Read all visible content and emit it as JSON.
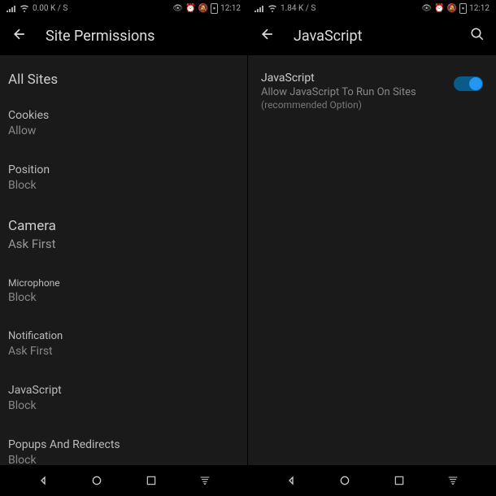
{
  "left": {
    "status": {
      "network_speed": "0.00 K / S",
      "time": "12:12"
    },
    "header": {
      "title": "Site Permissions"
    },
    "section_title": "All Sites",
    "settings": [
      {
        "label": "Cookies",
        "value": "Allow"
      },
      {
        "label": "Position",
        "value": "Block"
      },
      {
        "label": "Camera",
        "value": "Ask First"
      },
      {
        "label": "Microphone",
        "value": "Block"
      },
      {
        "label": "Notification",
        "value": "Ask First"
      },
      {
        "label": "JavaScript",
        "value": "Block"
      },
      {
        "label": "Popups And Redirects",
        "value": "Block"
      }
    ]
  },
  "right": {
    "status": {
      "network_speed": "1.84 K / S",
      "time": "12:12"
    },
    "header": {
      "title": "JavaScript"
    },
    "js_setting": {
      "title": "JavaScript",
      "subtitle": "Allow JavaScript To Run On Sites",
      "recommended": "(recommended Option)",
      "enabled": true
    }
  }
}
